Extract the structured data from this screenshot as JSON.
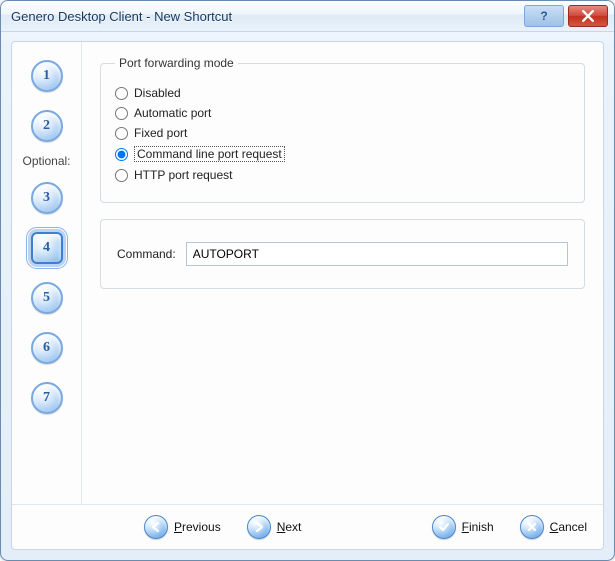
{
  "window": {
    "title": "Genero Desktop Client - New Shortcut"
  },
  "steps": {
    "optional_label": "Optional:",
    "items": [
      "1",
      "2",
      "3",
      "4",
      "5",
      "6",
      "7"
    ],
    "current_index": 3
  },
  "group": {
    "legend": "Port forwarding mode",
    "options": [
      {
        "label": "Disabled"
      },
      {
        "label": "Automatic port"
      },
      {
        "label": "Fixed port"
      },
      {
        "label": "Command line port request"
      },
      {
        "label": "HTTP port request"
      }
    ],
    "selected_index": 3
  },
  "command": {
    "label": "Command:",
    "value": "AUTOPORT"
  },
  "buttons": {
    "previous": "Previous",
    "next": "Next",
    "finish": "Finish",
    "cancel": "Cancel"
  }
}
